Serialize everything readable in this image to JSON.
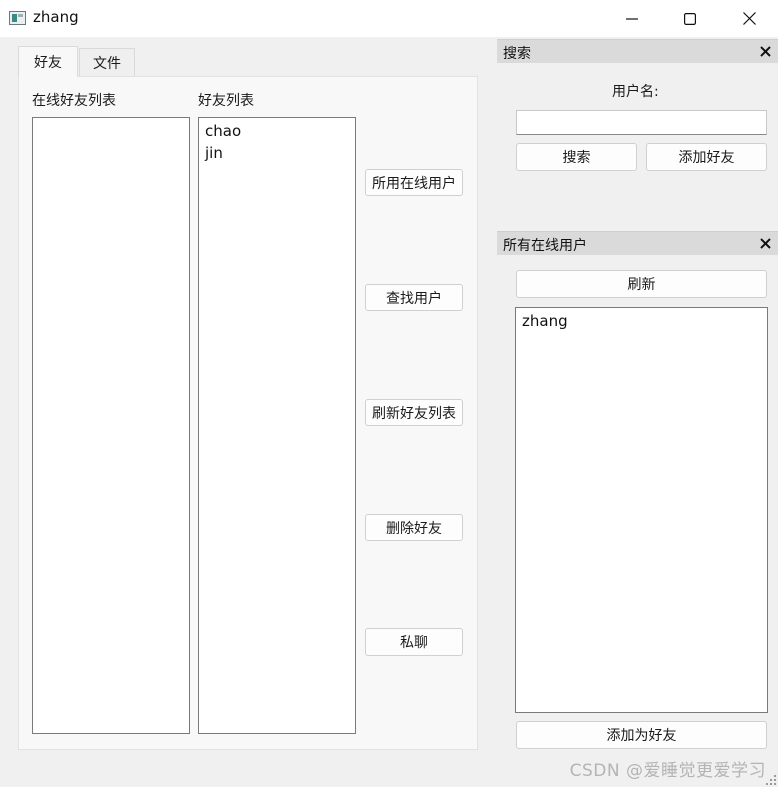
{
  "window": {
    "title": "zhang",
    "controls": {
      "minimize": "minimize-icon",
      "maximize": "maximize-icon",
      "close": "close-icon"
    }
  },
  "tabs": [
    {
      "label": "好友",
      "active": true
    },
    {
      "label": "文件",
      "active": false
    }
  ],
  "friends_tab": {
    "online_friends_label": "在线好友列表",
    "online_friends": [],
    "friend_list_label": "好友列表",
    "friends": [
      "chao",
      "jin"
    ],
    "buttons": {
      "all_online": "所用在线用户",
      "find_user": "查找用户",
      "refresh_friends": "刷新好友列表",
      "delete_friend": "删除好友",
      "private_chat": "私聊"
    }
  },
  "search_dock": {
    "title": "搜索",
    "username_label": "用户名:",
    "username_value": "",
    "search_button": "搜索",
    "add_friend_button": "添加好友"
  },
  "online_dock": {
    "title": "所有在线用户",
    "refresh_button": "刷新",
    "users": [
      "zhang"
    ],
    "add_as_friend_button": "添加为好友"
  },
  "watermark": "CSDN @爱睡觉更爱学习",
  "colors": {
    "window_bg": "#f0f0f0",
    "dock_title_bg": "#dadada",
    "list_border": "#7a7a7a"
  }
}
